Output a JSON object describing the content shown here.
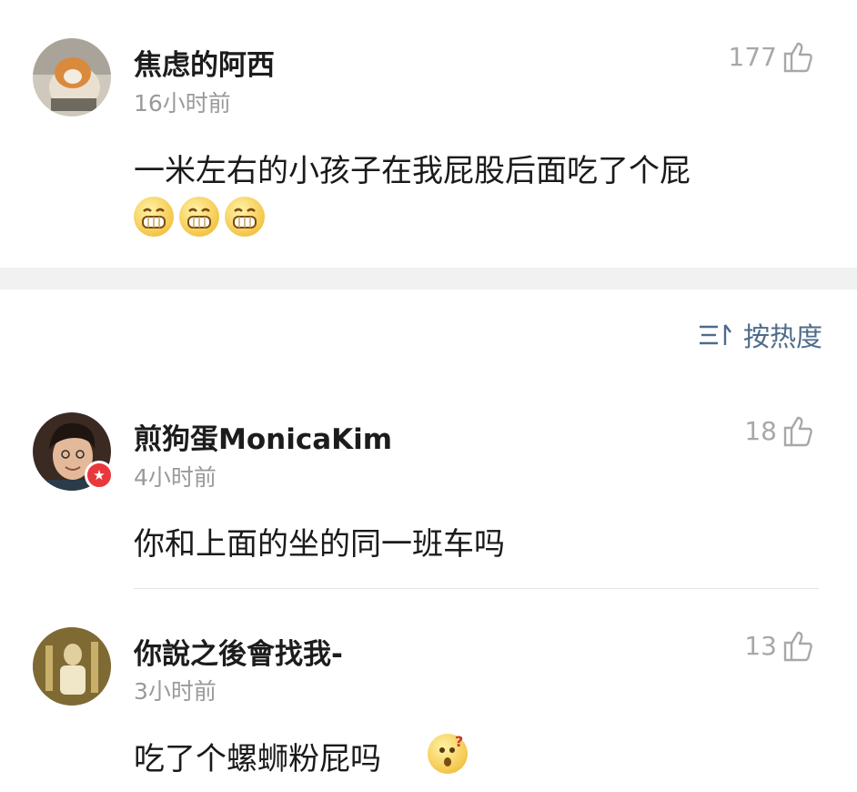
{
  "comments": [
    {
      "username": "焦虑的阿西",
      "time": "16小时前",
      "text": "一米左右的小孩子在我屁股后面吃了个屁",
      "likes": "177",
      "emoji": [
        "grin-emoji",
        "grin-emoji",
        "grin-emoji"
      ]
    },
    {
      "username": "煎狗蛋MonicaKim",
      "time": "4小时前",
      "text": "你和上面的坐的同一班车吗",
      "likes": "18"
    },
    {
      "username": "你說之後會找我-",
      "time": "3小时前",
      "text": "吃了个螺蛳粉屁吗",
      "likes": "13",
      "emoji": [
        "confused-emoji"
      ]
    }
  ],
  "sort": {
    "label": "按热度",
    "icon": "sort-icon"
  },
  "colors": {
    "link": "#4e6b8a",
    "muted": "#9a9a9a",
    "badge": "#e8383d"
  }
}
